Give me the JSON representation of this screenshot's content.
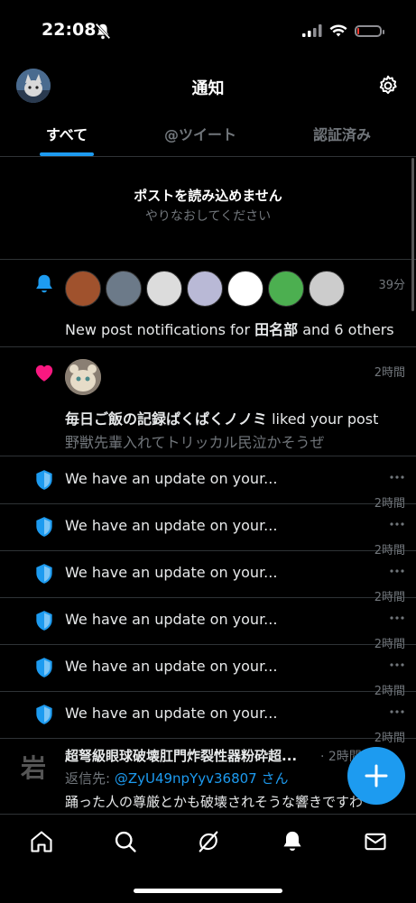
{
  "status_bar": {
    "time": "22:08",
    "battery_level": 0.1,
    "battery_color": "#ff3b30"
  },
  "header": {
    "title": "通知"
  },
  "tabs": [
    {
      "label": "すべて",
      "active": true
    },
    {
      "label": "@ツイート",
      "active": false
    },
    {
      "label": "認証済み",
      "active": false
    }
  ],
  "error": {
    "title": "ポストを読み込めません",
    "subtitle": "やりなおしてください"
  },
  "notifications": {
    "new_posts": {
      "icon": "bell-icon",
      "time": "39分",
      "text_prefix": "New post notifications for ",
      "name": "田名部",
      "text_suffix": " and 6 others",
      "avatars": [
        {
          "color": "#a0522d",
          "name": "avatar-1"
        },
        {
          "color": "#6c7a89",
          "name": "avatar-2"
        },
        {
          "color": "#dcdcdc",
          "name": "avatar-3"
        },
        {
          "color": "#b9b9d6",
          "name": "avatar-4"
        },
        {
          "color": "#ffffff",
          "name": "avatar-5"
        },
        {
          "color": "#4caf50",
          "name": "avatar-6"
        },
        {
          "color": "#cccccc",
          "name": "avatar-7"
        }
      ]
    },
    "like": {
      "icon": "heart-icon",
      "time": "2時間",
      "name": "毎日ご飯の記録ぱくぱくノノミ",
      "action": " liked your post",
      "snippet": "野獣先輩入れてトリッカル民泣かそうぜ"
    },
    "updates": [
      {
        "text": "We have an update on your...",
        "time": "2時間"
      },
      {
        "text": "We have an update on your...",
        "time": "2時間"
      },
      {
        "text": "We have an update on your...",
        "time": "2時間"
      },
      {
        "text": "We have an update on your...",
        "time": "2時間"
      },
      {
        "text": "We have an update on your...",
        "time": "2時間"
      },
      {
        "text": "We have an update on your...",
        "time": "2時間"
      }
    ],
    "reply": {
      "avatar_text": "岩",
      "title": "超弩級眼球破壊肛門炸裂性器粉砕超...",
      "time": "· 2時間",
      "reply_label": "返信先: ",
      "reply_handle": "@ZyU49npYyv36807 さん",
      "body": "踊った人の尊厳とかも破壊されそうな響きですわ"
    }
  },
  "colors": {
    "accent": "#1d9bf0",
    "like": "#f91880",
    "background": "#000000"
  },
  "tabbar": [
    "home-icon",
    "search-icon",
    "grok-icon",
    "bell-icon",
    "mail-icon"
  ],
  "fab": {
    "icon": "plus-icon"
  }
}
